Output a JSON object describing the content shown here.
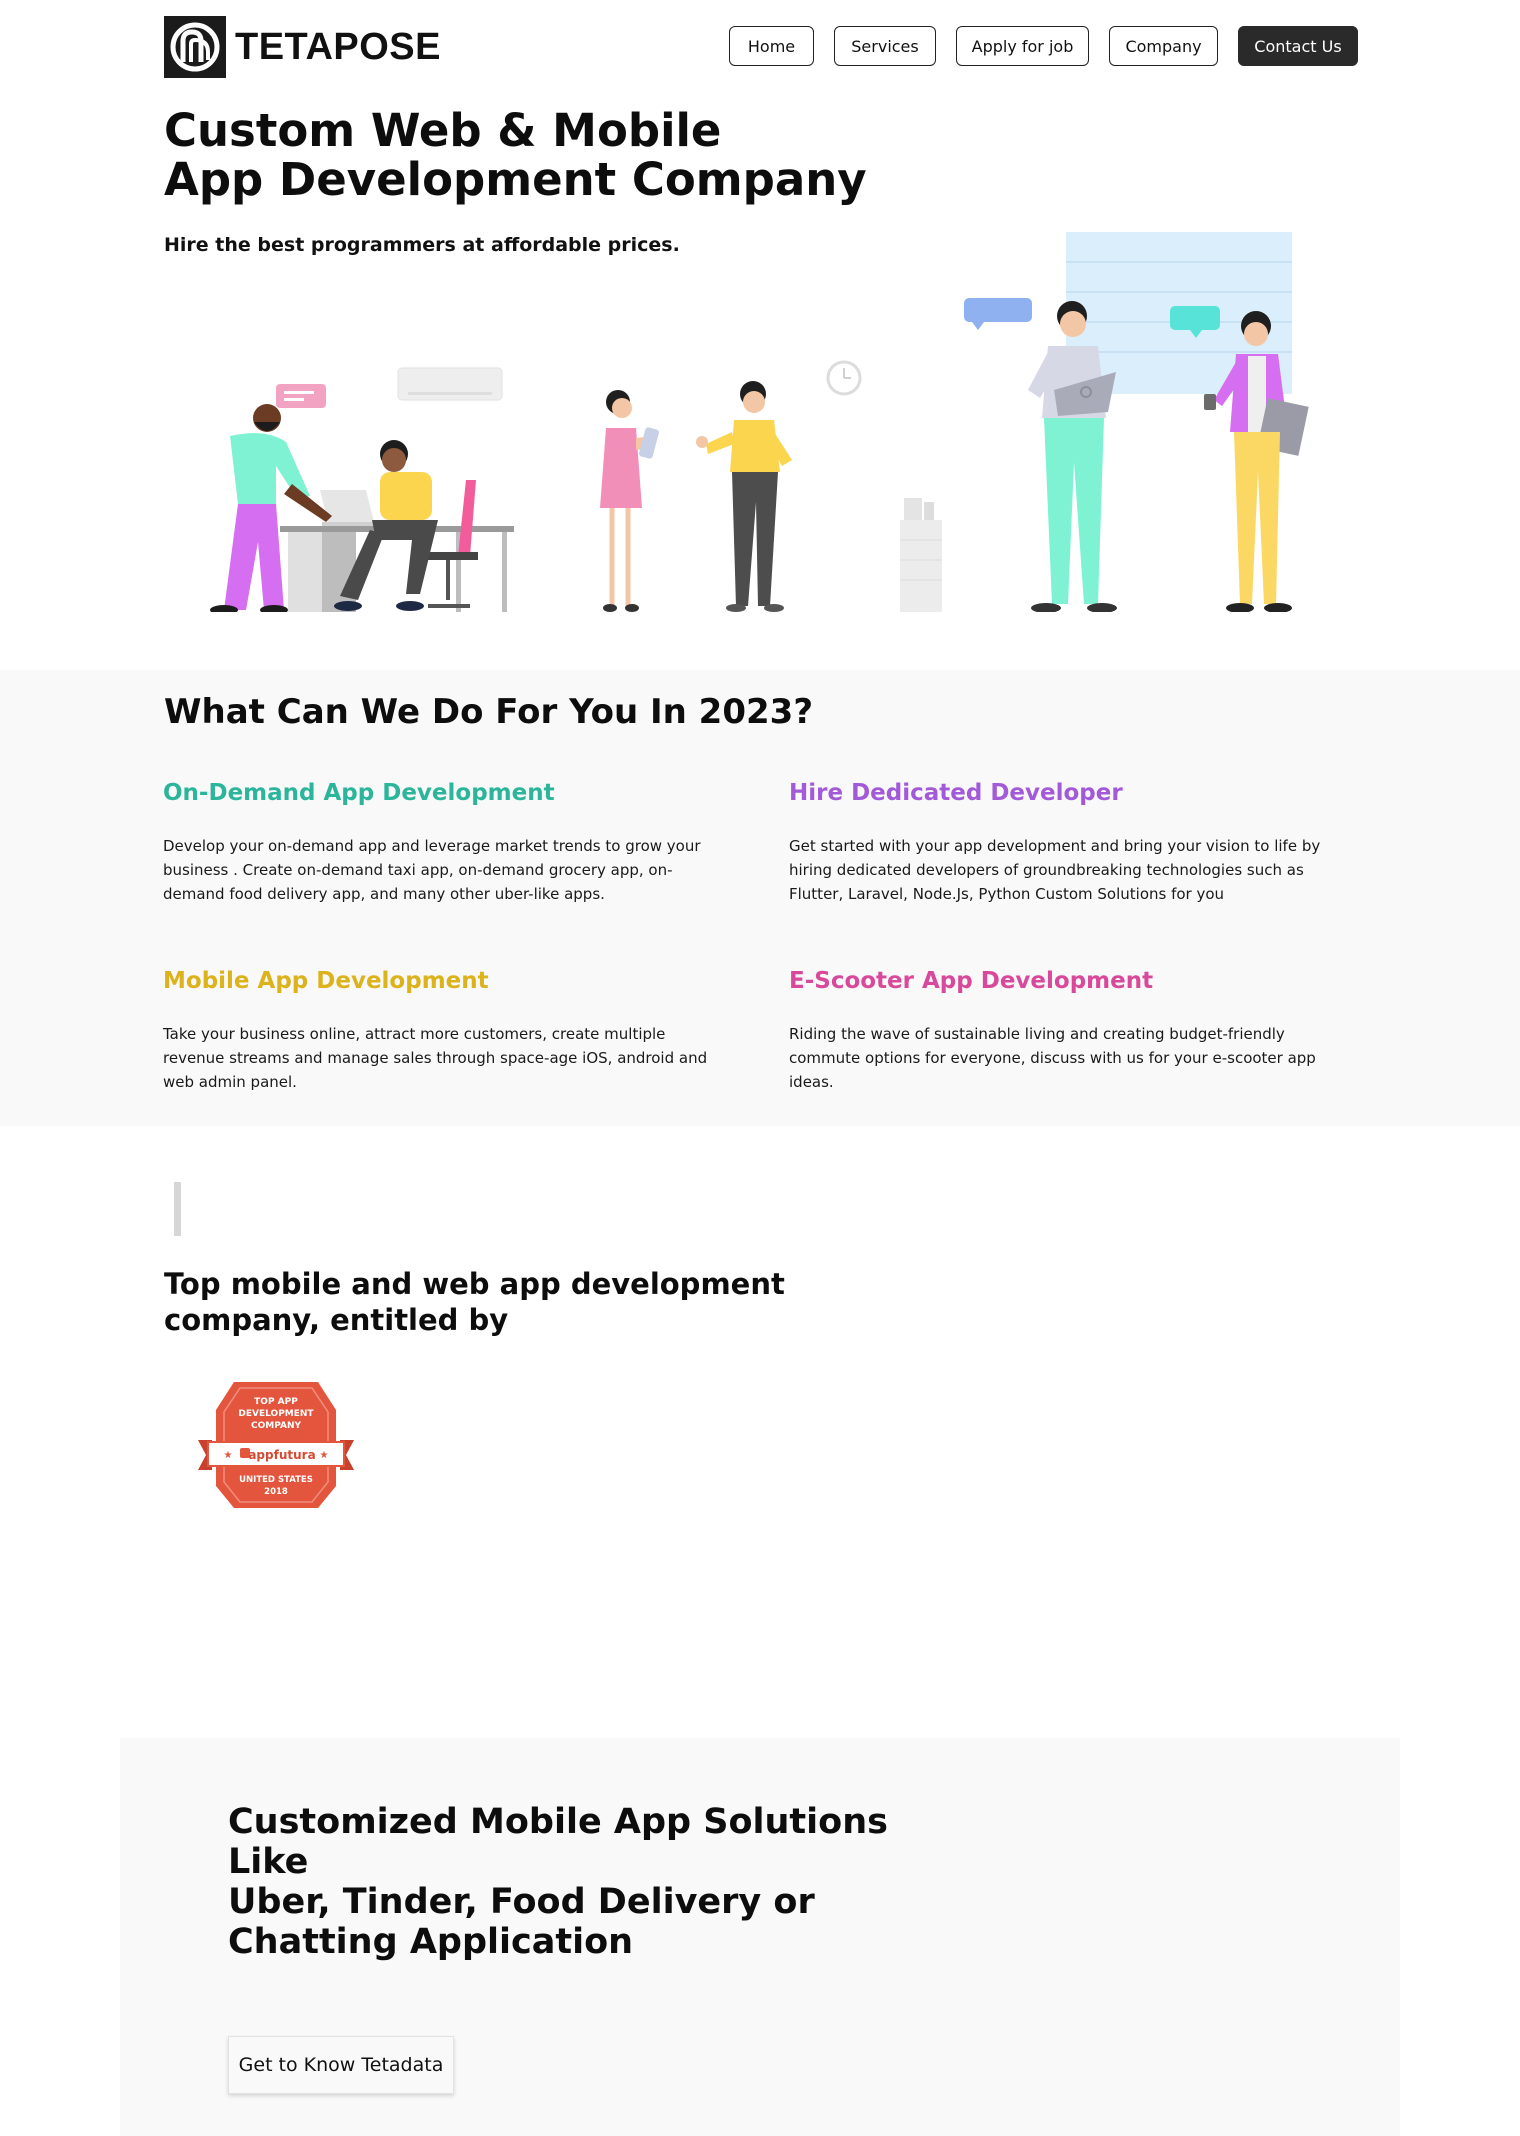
{
  "header": {
    "brand": "TETAPOSE",
    "nav": [
      {
        "label": "Home"
      },
      {
        "label": "Services"
      },
      {
        "label": "Apply for job"
      },
      {
        "label": "Company"
      },
      {
        "label": "Contact Us"
      }
    ]
  },
  "hero": {
    "title_line1": "Custom Web & Mobile",
    "title_line2": "App Development Company",
    "subtitle": "Hire the best programmers at affordable prices."
  },
  "services": {
    "title": "What Can We Do For You In 2023?",
    "items": [
      {
        "title": "On-Demand App Development",
        "color": "#2bb59a",
        "body": "Develop your on-demand app and leverage market trends to grow your business . Create on-demand taxi app, on-demand grocery app, on-demand food delivery app, and many other uber-like apps."
      },
      {
        "title": "Hire Dedicated Developer",
        "color": "#a25ad8",
        "body": "Get started with your app development and bring your vision to life by hiring dedicated developers of groundbreaking technologies such as Flutter, Laravel, Node.Js, Python Custom Solutions for you"
      },
      {
        "title": "Mobile App Development",
        "color": "#dcb21d",
        "body": "Take your business online, attract more customers, create multiple revenue streams and manage sales through space-age iOS, android and web admin panel."
      },
      {
        "title": "E-Scooter App Development",
        "color": "#d9499b",
        "body": "Riding the wave of sustainable living and creating budget-friendly commute options for everyone, discuss with us for your e-scooter app ideas."
      }
    ]
  },
  "recognition": {
    "title": "Top mobile and web app development company, entitled by",
    "badge": {
      "line1": "TOP APP",
      "line2": "DEVELOPMENT",
      "line3": "COMPANY",
      "brand": "appfutura",
      "country": "UNITED STATES",
      "year": "2018"
    }
  },
  "cta": {
    "title_line1": "Customized Mobile App Solutions Like",
    "title_line2": "Uber, Tinder, Food Delivery or",
    "title_line3": "Chatting Application",
    "button": "Get to Know Tetadata"
  }
}
